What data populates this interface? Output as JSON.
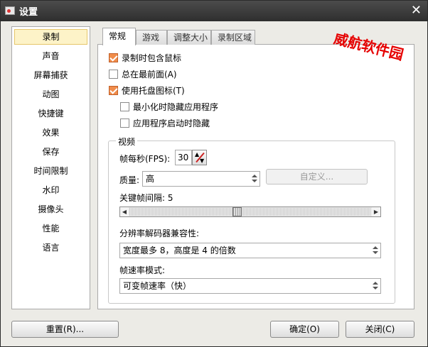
{
  "window": {
    "title": "设置",
    "close": "✕"
  },
  "sidebar": {
    "items": [
      "录制",
      "声音",
      "屏幕捕获",
      "动图",
      "快捷键",
      "效果",
      "保存",
      "时间限制",
      "水印",
      "摄像头",
      "性能",
      "语言"
    ],
    "selected": 0
  },
  "tabs": [
    "常规",
    "游戏",
    "调整大小",
    "录制区域"
  ],
  "active_tab": 0,
  "watermark": "威航软件园",
  "general": {
    "include_cursor": {
      "label": "录制时包含鼠标",
      "checked": true
    },
    "always_on_top": {
      "label": "总在最前面(A)",
      "checked": false
    },
    "tray_icon": {
      "label": "使用托盘图标(T)",
      "checked": true
    },
    "minimize_hide": {
      "label": "最小化时隐藏应用程序",
      "checked": false
    },
    "startup_hide": {
      "label": "应用程序启动时隐藏",
      "checked": false
    }
  },
  "video": {
    "group_label": "视频",
    "fps_label": "帧每秒(FPS):",
    "fps_value": "30",
    "quality_label": "质量:",
    "quality_value": "高",
    "custom_button": "自定义...",
    "keyframe_label": "关键帧间隔: 5",
    "keyframe_slider": {
      "min": 1,
      "max": 100,
      "value": 45
    },
    "codec_label": "分辨率解码器兼容性:",
    "codec_value": "宽度最多 8，高度是 4 的倍数",
    "framerate_label": "帧速率模式:",
    "framerate_value": "可变帧速率（快）"
  },
  "buttons": {
    "reset": "重置(R)...",
    "ok": "确定(O)",
    "close": "关闭(C)"
  }
}
